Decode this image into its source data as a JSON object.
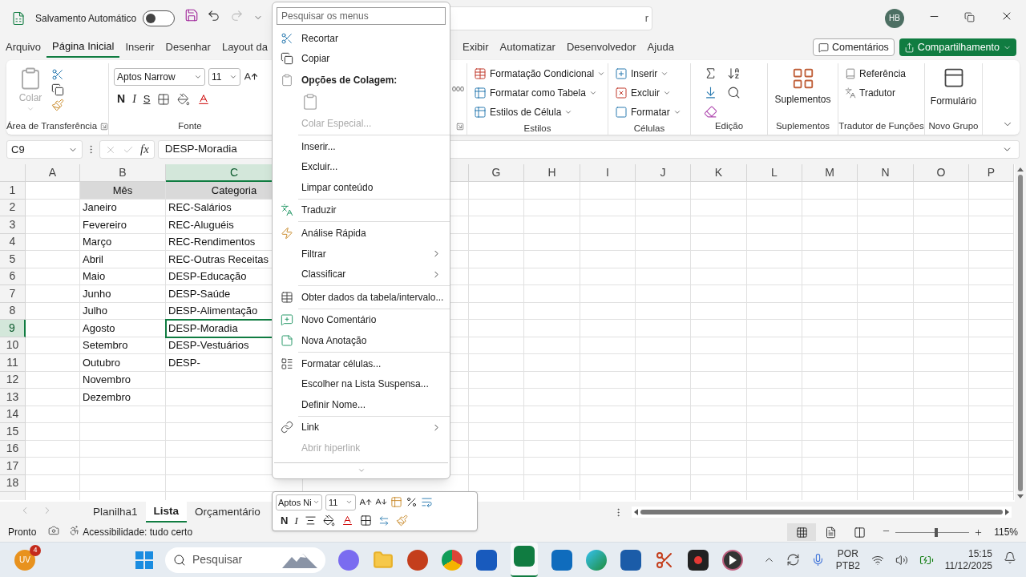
{
  "title_bar": {
    "autosave_label": "Salvamento Automático",
    "autosave_on": false,
    "search_visible_text": "r",
    "avatar": "HB"
  },
  "ribbon_tabs": [
    {
      "label": "Arquivo",
      "selected": false
    },
    {
      "label": "Página Inicial",
      "selected": true
    },
    {
      "label": "Inserir",
      "selected": false
    },
    {
      "label": "Desenhar",
      "selected": false
    },
    {
      "label": "Layout da",
      "selected": false
    },
    {
      "label": "Exibir",
      "selected": false
    },
    {
      "label": "Automatizar",
      "selected": false
    },
    {
      "label": "Desenvolvedor",
      "selected": false
    },
    {
      "label": "Ajuda",
      "selected": false
    }
  ],
  "comments_button": "Comentários",
  "share_button": "Compartilhamento",
  "ribbon": {
    "paste_label": "Colar",
    "paste_disabled": true,
    "clipboard_group": "Área de Transferência",
    "font_name": "Aptos Narrow",
    "font_size": "11",
    "bold": "N",
    "italic": "I",
    "underline": "S",
    "font_group": "Fonte",
    "number_visible": "000",
    "styles": [
      "Formatação Condicional",
      "Formatar como Tabela",
      "Estilos de Célula"
    ],
    "styles_group": "Estilos",
    "cells": [
      "Inserir",
      "Excluir",
      "Formatar"
    ],
    "cells_group": "Células",
    "editing_group": "Edição",
    "addins_label": "Suplementos",
    "addins_group": "Suplementos",
    "translator": [
      "Referência",
      "Tradutor"
    ],
    "translator_group": "Tradutor de Funções",
    "form_label": "Formulário",
    "new_group": "Novo Grupo"
  },
  "formula_bar": {
    "name_box": "C9",
    "fx": "fx",
    "value": "DESP-Moradia"
  },
  "sheet": {
    "columns": [
      {
        "letter": "A",
        "selected": false
      },
      {
        "letter": "B",
        "selected": false
      },
      {
        "letter": "C",
        "selected": true
      },
      {
        "letter": "G",
        "selected": false
      },
      {
        "letter": "H",
        "selected": false
      },
      {
        "letter": "I",
        "selected": false
      },
      {
        "letter": "J",
        "selected": false
      },
      {
        "letter": "K",
        "selected": false
      },
      {
        "letter": "L",
        "selected": false
      },
      {
        "letter": "M",
        "selected": false
      },
      {
        "letter": "N",
        "selected": false
      },
      {
        "letter": "O",
        "selected": false
      },
      {
        "letter": "P",
        "selected": false
      }
    ],
    "rows": [
      {
        "number": "1",
        "selected": false,
        "kind": "header",
        "b": "Mês",
        "c": "Categoria"
      },
      {
        "number": "2",
        "selected": false,
        "kind": "data",
        "b": "Janeiro",
        "c": "REC-Salários"
      },
      {
        "number": "3",
        "selected": false,
        "kind": "data",
        "b": "Fevereiro",
        "c": "REC-Aluguéis"
      },
      {
        "number": "4",
        "selected": false,
        "kind": "data",
        "b": "Março",
        "c": "REC-Rendimentos"
      },
      {
        "number": "5",
        "selected": false,
        "kind": "data",
        "b": "Abril",
        "c": "REC-Outras Receitas"
      },
      {
        "number": "6",
        "selected": false,
        "kind": "data",
        "b": "Maio",
        "c": "DESP-Educação"
      },
      {
        "number": "7",
        "selected": false,
        "kind": "data",
        "b": "Junho",
        "c": "DESP-Saúde"
      },
      {
        "number": "8",
        "selected": false,
        "kind": "data",
        "b": "Julho",
        "c": "DESP-Alimentação"
      },
      {
        "number": "9",
        "selected": true,
        "kind": "data",
        "b": "Agosto",
        "c": "DESP-Moradia"
      },
      {
        "number": "10",
        "selected": false,
        "kind": "data",
        "b": "Setembro",
        "c": "DESP-Vestuários"
      },
      {
        "number": "11",
        "selected": false,
        "kind": "data",
        "b": "Outubro",
        "c": "DESP-"
      },
      {
        "number": "12",
        "selected": false,
        "kind": "data",
        "b": "Novembro"
      },
      {
        "number": "13",
        "selected": false,
        "kind": "data",
        "b": "Dezembro"
      },
      {
        "number": "14",
        "selected": false,
        "kind": "data"
      },
      {
        "number": "15",
        "selected": false,
        "kind": "data"
      },
      {
        "number": "16",
        "selected": false,
        "kind": "data"
      },
      {
        "number": "17",
        "selected": false,
        "kind": "data"
      },
      {
        "number": "18",
        "selected": false,
        "kind": "data"
      }
    ]
  },
  "sheet_tabs": [
    {
      "label": "Planilha1",
      "selected": false
    },
    {
      "label": "Lista",
      "selected": true
    },
    {
      "label": "Orçamentário",
      "selected": false
    }
  ],
  "status_bar": {
    "status": "Pronto",
    "accessibility": "Acessibilidade: tudo certo",
    "views": [
      {
        "selected": true
      },
      {
        "selected": false
      },
      {
        "selected": false
      }
    ],
    "zoom": {
      "level": 0.55
    },
    "zoom_label": "115%"
  },
  "context_menu": {
    "search_placeholder": "Pesquisar os menus",
    "items": [
      {
        "kind": "item",
        "label": "Recortar",
        "disabled": false
      },
      {
        "kind": "item",
        "label": "Copiar",
        "disabled": false
      },
      {
        "kind": "header",
        "label": "Opções de Colagem:"
      },
      {
        "kind": "paste"
      },
      {
        "kind": "item",
        "label": "Colar Especial...",
        "disabled": true
      },
      {
        "kind": "separator"
      },
      {
        "kind": "item",
        "label": "Inserir...",
        "disabled": false
      },
      {
        "kind": "item",
        "label": "Excluir...",
        "disabled": false
      },
      {
        "kind": "item",
        "label": "Limpar conteúdo",
        "disabled": false
      },
      {
        "kind": "separator"
      },
      {
        "kind": "item",
        "label": "Traduzir",
        "disabled": false
      },
      {
        "kind": "separator"
      },
      {
        "kind": "item",
        "label": "Análise Rápida",
        "disabled": false
      },
      {
        "kind": "submenu",
        "label": "Filtrar",
        "disabled": false
      },
      {
        "kind": "submenu",
        "label": "Classificar",
        "disabled": false
      },
      {
        "kind": "separator"
      },
      {
        "kind": "item",
        "label": "Obter dados da tabela/intervalo...",
        "disabled": false
      },
      {
        "kind": "separator"
      },
      {
        "kind": "item",
        "label": "Novo Comentário",
        "disabled": false
      },
      {
        "kind": "item",
        "label": "Nova Anotação",
        "disabled": false
      },
      {
        "kind": "separator"
      },
      {
        "kind": "item",
        "label": "Formatar células...",
        "disabled": false
      },
      {
        "kind": "item",
        "label": "Escolher na Lista Suspensa...",
        "disabled": false
      },
      {
        "kind": "item",
        "label": "Definir Nome...",
        "disabled": false
      },
      {
        "kind": "separator"
      },
      {
        "kind": "submenu",
        "label": "Link",
        "disabled": false
      },
      {
        "kind": "item",
        "label": "Abrir hiperlink",
        "disabled": true
      }
    ]
  },
  "mini_toolbar": {
    "font_name": "Aptos Ni",
    "font_size": "11",
    "bold": "N",
    "italic": "I"
  },
  "taskbar": {
    "widget_badge": "4",
    "widget_text": "UV",
    "search_placeholder": "Pesquisar",
    "language": "POR",
    "layout": "PTB2",
    "time": "15:15",
    "date": "11/12/2025"
  }
}
